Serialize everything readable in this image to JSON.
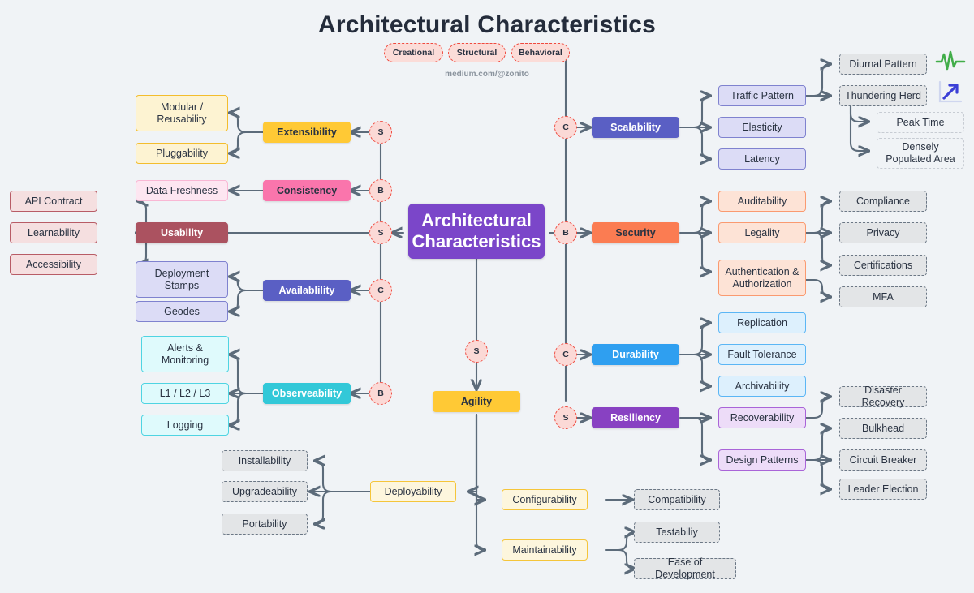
{
  "header": {
    "title": "Architectural Characteristics",
    "credit": "medium.com/@zonito",
    "legend": [
      {
        "label": "Creational",
        "key": "C"
      },
      {
        "label": "Structural",
        "key": "S"
      },
      {
        "label": "Behavioral",
        "key": "B"
      }
    ]
  },
  "center": {
    "label": "Architectural\nCharacteristics",
    "line1": "Architectural",
    "line2": "Characteristics"
  },
  "badges": {
    "extensibility": "S",
    "consistency": "B",
    "usability": "S",
    "availability": "C",
    "observeability": "B",
    "agility": "S",
    "scalability": "C",
    "security": "B",
    "durability": "C",
    "resiliency": "S"
  },
  "nodes": {
    "extensibility": "Extensibility",
    "modular_reusability": "Modular /\nReusability",
    "modular_reusability_l1": "Modular /",
    "modular_reusability_l2": "Reusability",
    "pluggability": "Pluggability",
    "consistency": "Consistency",
    "data_freshness": "Data Freshness",
    "usability": "Usability",
    "api_contract": "API Contract",
    "learnability": "Learnability",
    "accessibility": "Accessibility",
    "availability": "Availablility",
    "deployment_stamps_l1": "Deployment",
    "deployment_stamps_l2": "Stamps",
    "geodes": "Geodes",
    "observeability": "Observeability",
    "alerts_monitoring_l1": "Alerts &",
    "alerts_monitoring_l2": "Monitoring",
    "l1_l2_l3": "L1 / L2 / L3",
    "logging": "Logging",
    "deployability": "Deployability",
    "installability": "Installability",
    "upgradeability": "Upgradeability",
    "portability": "Portability",
    "agility": "Agility",
    "configurability": "Configurability",
    "compatibility": "Compatibility",
    "maintainability": "Maintainability",
    "testability": "Testabiliy",
    "ease_of_development": "Ease of Development",
    "scalability": "Scalability",
    "traffic_pattern": "Traffic Pattern",
    "elasticity": "Elasticity",
    "latency": "Latency",
    "diurnal_pattern": "Diurnal Pattern",
    "thundering_herd": "Thundering Herd",
    "peak_time": "Peak Time",
    "densely_populated_l1": "Densely",
    "densely_populated_l2": "Populated Area",
    "security": "Security",
    "auditability": "Auditability",
    "legality": "Legality",
    "authn_authz_l1": "Authentication &",
    "authn_authz_l2": "Authorization",
    "compliance": "Compliance",
    "privacy": "Privacy",
    "certifications": "Certifications",
    "mfa": "MFA",
    "durability": "Durability",
    "replication": "Replication",
    "fault_tolerance": "Fault Tolerance",
    "archivability": "Archivability",
    "resiliency": "Resiliency",
    "recoverability": "Recoverability",
    "design_patterns": "Design Patterns",
    "disaster_recovery": "Disaster Recovery",
    "bulkhead": "Bulkhead",
    "circuit_breaker": "Circuit Breaker",
    "leader_election": "Leader Election"
  },
  "icons": {
    "pulse": "pulse-waveform-icon",
    "trend": "trend-arrow-up-icon"
  },
  "colors": {
    "background": "#f0f3f6",
    "title_text": "#242c3b",
    "center_purple": "#7b46c9",
    "amber": "#ffc935",
    "pink": "#fa75ac",
    "maroon": "#ab5260",
    "indigo": "#5a5fc4",
    "cyan": "#32c8d8",
    "orange": "#fb7c52",
    "blue": "#2f9ff0",
    "purple": "#8841c2",
    "grey_dashed": "#6b7785",
    "connector": "#5c6b7a",
    "badge_fill": "#fbd9d6",
    "badge_border": "#ef4a3f",
    "pulse_green": "#41ad49",
    "trend_blue": "#3b3fd6"
  }
}
